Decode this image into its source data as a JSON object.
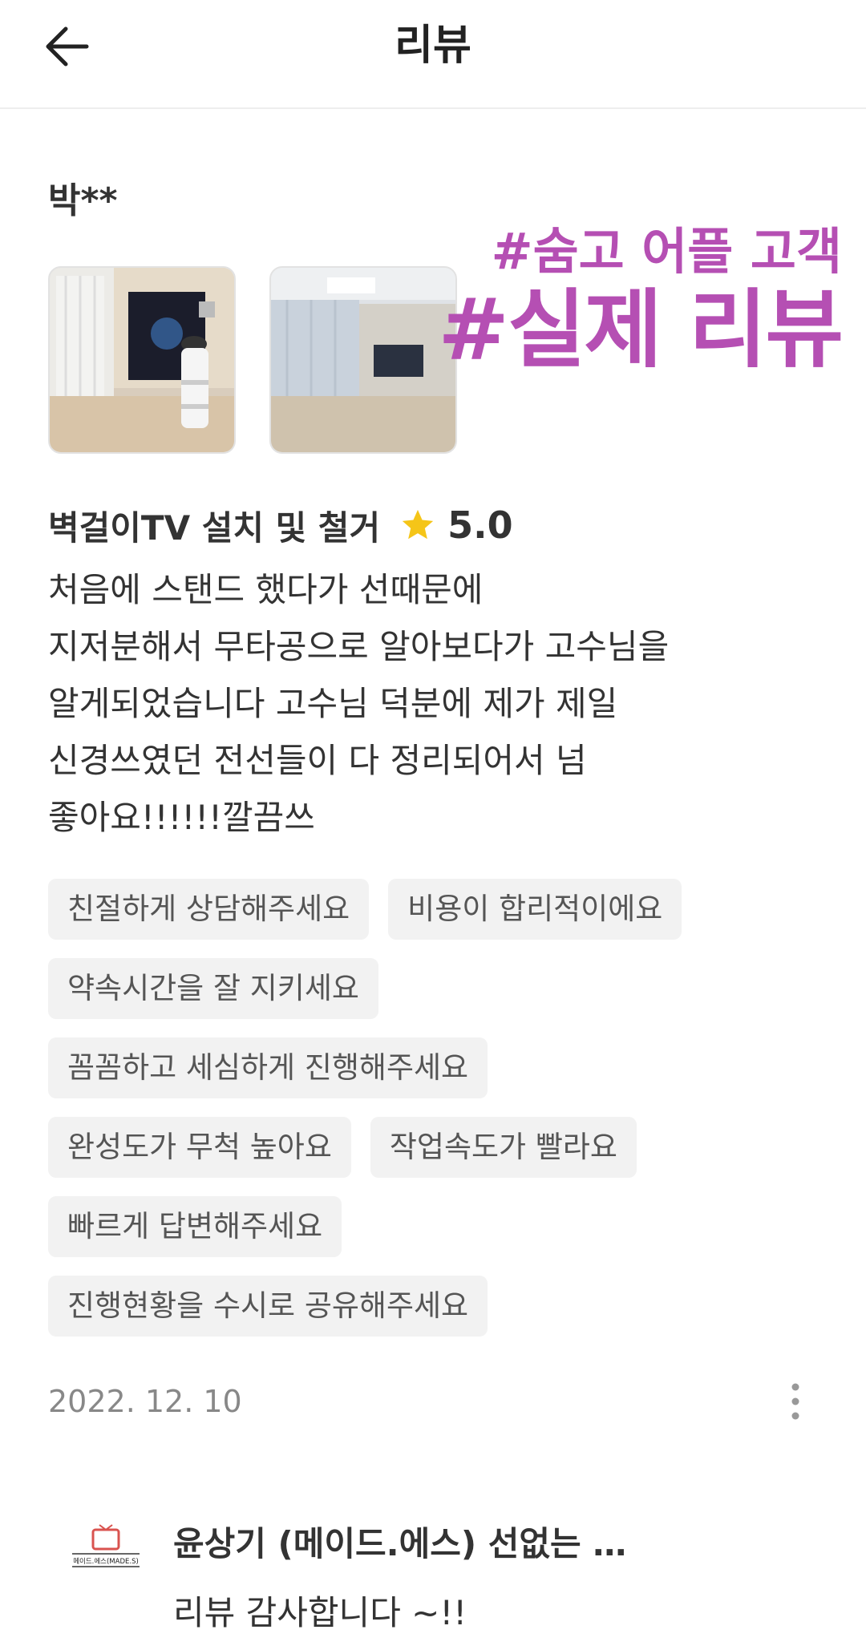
{
  "header": {
    "back_icon": "arrow-left-icon",
    "title": "리뷰"
  },
  "review": {
    "reviewer": "박**",
    "photos": [
      {
        "name": "review-photo-1",
        "alt": "wall-mounted TV with air purifier"
      },
      {
        "name": "review-photo-2",
        "alt": "wall-mounted TV in living room"
      }
    ],
    "promo": {
      "line1": "#숨고 어플 고객",
      "line2": "#실제 리뷰",
      "color": "#b54fb3"
    },
    "service": "벽걸이TV 설치 및 철거",
    "star_icon": "star-icon",
    "rating": "5.0",
    "text": "처음에 스탠드 했다가 선때문에\n지저분해서 무타공으로 알아보다가 고수님을\n알게되었습니다 고수님 덕분에 제가 제일\n신경쓰였던 전선들이 다 정리되어서 넘\n좋아요!!!!!!깔끔쓰",
    "tags": [
      "친절하게 상담해주세요",
      "비용이 합리적이에요",
      "약속시간을 잘 지키세요",
      "꼼꼼하고 세심하게 진행해주세요",
      "완성도가 무척 높아요",
      "작업속도가 빨라요",
      "빠르게 답변해주세요",
      "진행현황을 수시로 공유해주세요"
    ],
    "date": "2022. 12. 10",
    "more_icon": "more-vertical-icon"
  },
  "reply": {
    "logo_text": "메이드.에스(MADE.S)",
    "name": "윤상기 (메이드.에스) 선없는 …",
    "text": "리뷰 감사합니다 ~!!"
  },
  "colors": {
    "accent": "#b54fb3",
    "star": "#f5c518",
    "tag_bg": "#f2f2f2"
  }
}
